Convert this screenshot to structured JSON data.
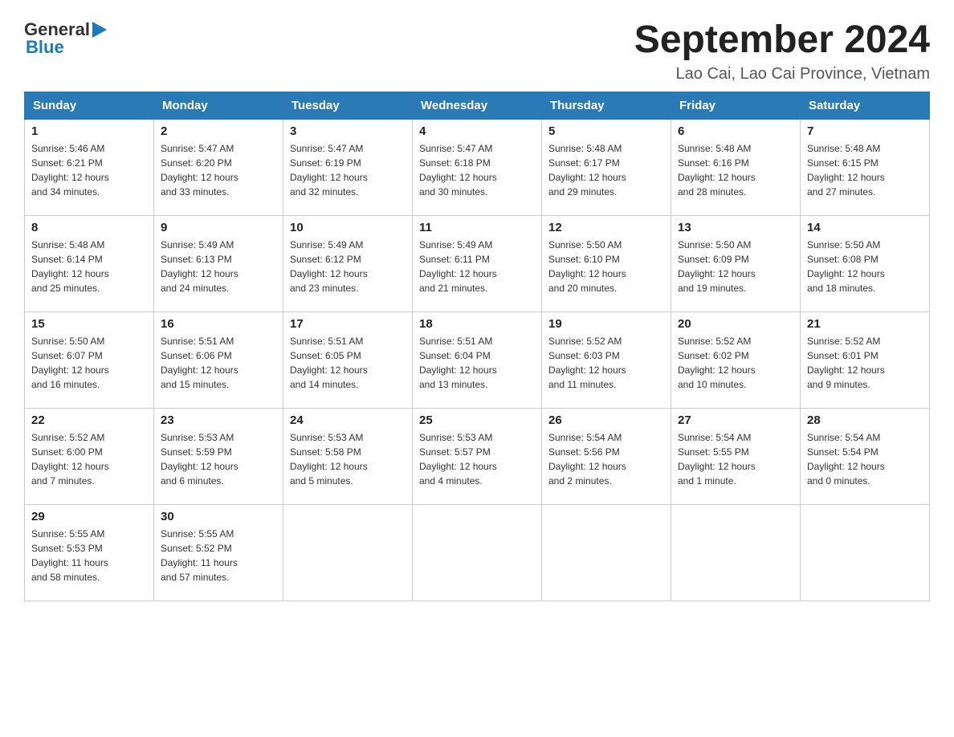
{
  "header": {
    "logo_general": "General",
    "logo_blue": "Blue",
    "title": "September 2024",
    "subtitle": "Lao Cai, Lao Cai Province, Vietnam"
  },
  "days_of_week": [
    "Sunday",
    "Monday",
    "Tuesday",
    "Wednesday",
    "Thursday",
    "Friday",
    "Saturday"
  ],
  "weeks": [
    [
      {
        "day": "1",
        "sunrise": "5:46 AM",
        "sunset": "6:21 PM",
        "daylight": "12 hours and 34 minutes."
      },
      {
        "day": "2",
        "sunrise": "5:47 AM",
        "sunset": "6:20 PM",
        "daylight": "12 hours and 33 minutes."
      },
      {
        "day": "3",
        "sunrise": "5:47 AM",
        "sunset": "6:19 PM",
        "daylight": "12 hours and 32 minutes."
      },
      {
        "day": "4",
        "sunrise": "5:47 AM",
        "sunset": "6:18 PM",
        "daylight": "12 hours and 30 minutes."
      },
      {
        "day": "5",
        "sunrise": "5:48 AM",
        "sunset": "6:17 PM",
        "daylight": "12 hours and 29 minutes."
      },
      {
        "day": "6",
        "sunrise": "5:48 AM",
        "sunset": "6:16 PM",
        "daylight": "12 hours and 28 minutes."
      },
      {
        "day": "7",
        "sunrise": "5:48 AM",
        "sunset": "6:15 PM",
        "daylight": "12 hours and 27 minutes."
      }
    ],
    [
      {
        "day": "8",
        "sunrise": "5:48 AM",
        "sunset": "6:14 PM",
        "daylight": "12 hours and 25 minutes."
      },
      {
        "day": "9",
        "sunrise": "5:49 AM",
        "sunset": "6:13 PM",
        "daylight": "12 hours and 24 minutes."
      },
      {
        "day": "10",
        "sunrise": "5:49 AM",
        "sunset": "6:12 PM",
        "daylight": "12 hours and 23 minutes."
      },
      {
        "day": "11",
        "sunrise": "5:49 AM",
        "sunset": "6:11 PM",
        "daylight": "12 hours and 21 minutes."
      },
      {
        "day": "12",
        "sunrise": "5:50 AM",
        "sunset": "6:10 PM",
        "daylight": "12 hours and 20 minutes."
      },
      {
        "day": "13",
        "sunrise": "5:50 AM",
        "sunset": "6:09 PM",
        "daylight": "12 hours and 19 minutes."
      },
      {
        "day": "14",
        "sunrise": "5:50 AM",
        "sunset": "6:08 PM",
        "daylight": "12 hours and 18 minutes."
      }
    ],
    [
      {
        "day": "15",
        "sunrise": "5:50 AM",
        "sunset": "6:07 PM",
        "daylight": "12 hours and 16 minutes."
      },
      {
        "day": "16",
        "sunrise": "5:51 AM",
        "sunset": "6:06 PM",
        "daylight": "12 hours and 15 minutes."
      },
      {
        "day": "17",
        "sunrise": "5:51 AM",
        "sunset": "6:05 PM",
        "daylight": "12 hours and 14 minutes."
      },
      {
        "day": "18",
        "sunrise": "5:51 AM",
        "sunset": "6:04 PM",
        "daylight": "12 hours and 13 minutes."
      },
      {
        "day": "19",
        "sunrise": "5:52 AM",
        "sunset": "6:03 PM",
        "daylight": "12 hours and 11 minutes."
      },
      {
        "day": "20",
        "sunrise": "5:52 AM",
        "sunset": "6:02 PM",
        "daylight": "12 hours and 10 minutes."
      },
      {
        "day": "21",
        "sunrise": "5:52 AM",
        "sunset": "6:01 PM",
        "daylight": "12 hours and 9 minutes."
      }
    ],
    [
      {
        "day": "22",
        "sunrise": "5:52 AM",
        "sunset": "6:00 PM",
        "daylight": "12 hours and 7 minutes."
      },
      {
        "day": "23",
        "sunrise": "5:53 AM",
        "sunset": "5:59 PM",
        "daylight": "12 hours and 6 minutes."
      },
      {
        "day": "24",
        "sunrise": "5:53 AM",
        "sunset": "5:58 PM",
        "daylight": "12 hours and 5 minutes."
      },
      {
        "day": "25",
        "sunrise": "5:53 AM",
        "sunset": "5:57 PM",
        "daylight": "12 hours and 4 minutes."
      },
      {
        "day": "26",
        "sunrise": "5:54 AM",
        "sunset": "5:56 PM",
        "daylight": "12 hours and 2 minutes."
      },
      {
        "day": "27",
        "sunrise": "5:54 AM",
        "sunset": "5:55 PM",
        "daylight": "12 hours and 1 minute."
      },
      {
        "day": "28",
        "sunrise": "5:54 AM",
        "sunset": "5:54 PM",
        "daylight": "12 hours and 0 minutes."
      }
    ],
    [
      {
        "day": "29",
        "sunrise": "5:55 AM",
        "sunset": "5:53 PM",
        "daylight": "11 hours and 58 minutes."
      },
      {
        "day": "30",
        "sunrise": "5:55 AM",
        "sunset": "5:52 PM",
        "daylight": "11 hours and 57 minutes."
      },
      null,
      null,
      null,
      null,
      null
    ]
  ],
  "labels": {
    "sunrise": "Sunrise:",
    "sunset": "Sunset:",
    "daylight": "Daylight:"
  }
}
